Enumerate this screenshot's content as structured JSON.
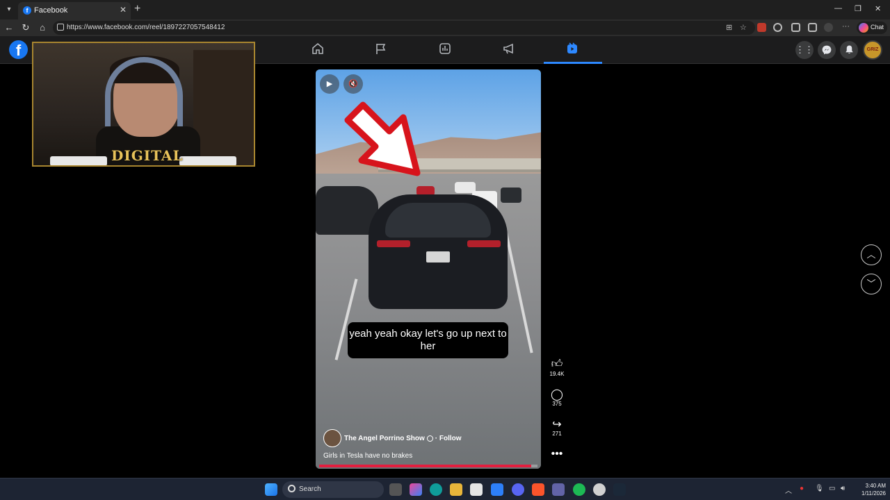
{
  "browser": {
    "tab_title": "Facebook",
    "url": "https://www.facebook.com/reel/1897227057548412",
    "chat_label": "Chat"
  },
  "webcam": {
    "logo_text": "DIGITAL"
  },
  "reel": {
    "caption": "yeah yeah okay let's go up next to her",
    "author": "The Angel Porrino Show",
    "follow_label": "Follow",
    "description": "Girls in Tesla have no brakes",
    "progress_fraction": 0.97,
    "likes": "19.4K",
    "comments": "375",
    "shares": "271"
  },
  "facebook_nav": {
    "active_tab": "video"
  },
  "taskbar": {
    "search_label": "Search",
    "time": "3:40 AM",
    "date": "1/11/2026"
  },
  "icons": [
    "home-icon",
    "flag-icon",
    "dashboard-icon",
    "megaphone-icon",
    "reels-icon",
    "grid-menu-icon",
    "messenger-icon",
    "bell-icon"
  ]
}
